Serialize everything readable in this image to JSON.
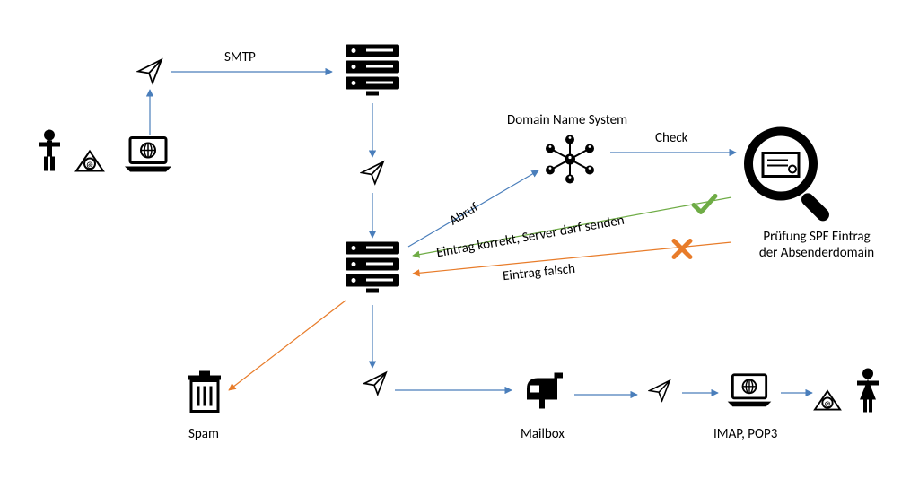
{
  "labels": {
    "smtp": "SMTP",
    "dns": "Domain Name System",
    "check": "Check",
    "abruf": "Abruf",
    "correct": "Eintrag korrekt, Server darf senden",
    "wrong": "Eintrag falsch",
    "spf1": "Prüfung SPF Eintrag",
    "spf2": "der Absenderdomain",
    "spam": "Spam",
    "mailbox": "Mailbox",
    "imap": "IMAP, POP3"
  },
  "diagram": {
    "description": "Email delivery flow with SPF validation",
    "language": "de",
    "nodes": [
      {
        "id": "sender-person",
        "type": "person"
      },
      {
        "id": "sender-email",
        "type": "email-at-icon"
      },
      {
        "id": "sender-laptop",
        "type": "laptop-globe"
      },
      {
        "id": "send-plane",
        "type": "paper-plane"
      },
      {
        "id": "server1",
        "type": "mail-server"
      },
      {
        "id": "transit-plane",
        "type": "paper-plane"
      },
      {
        "id": "server2",
        "type": "mail-server"
      },
      {
        "id": "dns",
        "type": "dns-network"
      },
      {
        "id": "spf-check",
        "type": "magnifier-certificate"
      },
      {
        "id": "result-ok",
        "type": "checkmark",
        "color": "green"
      },
      {
        "id": "result-bad",
        "type": "cross",
        "color": "orange"
      },
      {
        "id": "trash",
        "type": "trash-bin"
      },
      {
        "id": "deliver-plane",
        "type": "paper-plane"
      },
      {
        "id": "mailbox",
        "type": "mailbox"
      },
      {
        "id": "retrieve-plane",
        "type": "paper-plane"
      },
      {
        "id": "recipient-laptop",
        "type": "laptop-globe"
      },
      {
        "id": "recipient-email",
        "type": "email-at-icon"
      },
      {
        "id": "recipient-person",
        "type": "person-female"
      }
    ],
    "edges": [
      {
        "from": "sender-laptop",
        "to": "send-plane",
        "style": "blue"
      },
      {
        "from": "send-plane",
        "to": "server1",
        "label": "SMTP",
        "style": "blue"
      },
      {
        "from": "server1",
        "to": "transit-plane",
        "style": "blue"
      },
      {
        "from": "transit-plane",
        "to": "server2",
        "style": "blue"
      },
      {
        "from": "server2",
        "to": "dns",
        "label": "Abruf",
        "style": "blue"
      },
      {
        "from": "dns",
        "to": "spf-check",
        "label": "Check",
        "style": "blue"
      },
      {
        "from": "spf-check",
        "to": "server2",
        "label": "Eintrag korrekt, Server darf senden",
        "style": "green"
      },
      {
        "from": "spf-check",
        "to": "server2",
        "label": "Eintrag falsch",
        "style": "orange"
      },
      {
        "from": "server2",
        "to": "trash",
        "label": "Spam",
        "style": "orange"
      },
      {
        "from": "server2",
        "to": "deliver-plane",
        "style": "blue"
      },
      {
        "from": "deliver-plane",
        "to": "mailbox",
        "style": "blue"
      },
      {
        "from": "mailbox",
        "to": "retrieve-plane",
        "style": "blue"
      },
      {
        "from": "retrieve-plane",
        "to": "recipient-laptop",
        "style": "blue"
      },
      {
        "from": "recipient-laptop",
        "to": "recipient-email",
        "style": "blue"
      }
    ]
  }
}
